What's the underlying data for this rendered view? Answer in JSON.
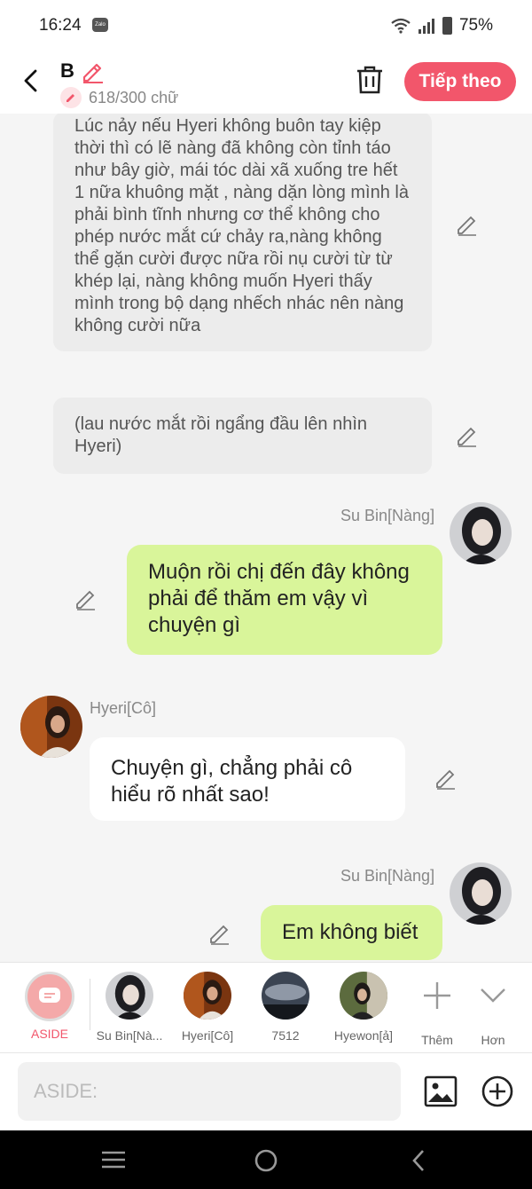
{
  "status": {
    "time": "16:24",
    "battery": "75%",
    "app_badge": "Zalo"
  },
  "header": {
    "title": "B",
    "word_count": "618/300 chữ",
    "next_label": "Tiếp theo"
  },
  "messages": {
    "narr1": "Lúc nảy nếu Hyeri không buôn tay kiệp thời thì có lẽ nàng đã không còn tỉnh táo như bây giờ, mái tóc dài xã xuống tre hết 1 nữa khuông mặt , nàng dặn lòng mình là phải bình tĩnh nhưng cơ thể không cho phép nước mắt cứ chảy ra,nàng không thể gặn cười được nữa rồi nụ cười từ từ khép lại, nàng không muốn Hyeri thấy mình trong bộ dạng nhếch nhác nên nàng không cười nữa",
    "narr2": "(lau nước mắt rồi ngẩng đầu lên nhìn Hyeri)",
    "m1_name": "Su Bin[Nàng]",
    "m1_text": "Muộn rồi chị đến đây không phải để thăm em vậy vì chuyện gì",
    "m2_name": "Hyeri[Cô]",
    "m2_text": "Chuyện gì, chẳng phải cô hiểu rõ nhất sao!",
    "m3_name": "Su Bin[Nàng]",
    "m3_text": "Em không biết"
  },
  "characters": {
    "aside": "ASIDE",
    "c1": "Su Bin[Nà...",
    "c2": "Hyeri[Cô]",
    "c3": "7512",
    "c4": "Hyewon[ả]",
    "more": "Thêm",
    "collapse": "Hơn"
  },
  "input": {
    "placeholder": "ASIDE:"
  },
  "colors": {
    "accent": "#f2566b",
    "bubble_green": "#d9f59a",
    "narr_bg": "#ececec"
  }
}
